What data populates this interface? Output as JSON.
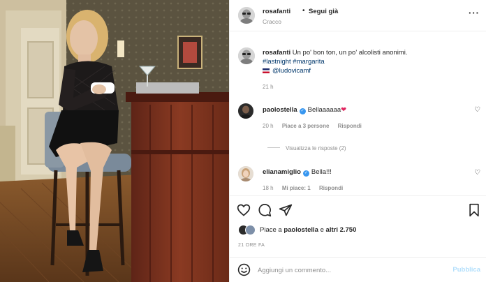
{
  "post": {
    "author": "rosafanti",
    "follow_label": "Segui già",
    "location": "Cracco",
    "more_glyph": "···"
  },
  "caption": {
    "username": "rosafanti",
    "text": "Un po' bon ton, un po' alcolisti anonimi.",
    "hashtags": "#lastnight #margarita",
    "mention": "@ludovicamf",
    "time": "21 h"
  },
  "comments": [
    {
      "username": "paolostella",
      "text": "Bellaaaaaa",
      "emoji": "❤",
      "time": "20 h",
      "likes": "Piace a 3 persone",
      "reply": "Rispondi"
    },
    {
      "username": "elianamiglio",
      "text": "Bella!!!",
      "time": "18 h",
      "likes": "Mi piace: 1",
      "reply": "Rispondi"
    }
  ],
  "view_replies": "Visualizza le risposte (2)",
  "likes_bar": {
    "prefix": "Piace a",
    "user": "paolostella",
    "joiner": "e",
    "others": "altri 2.750"
  },
  "posted_ago": "21 ORE FA",
  "add_comment": {
    "placeholder": "Aggiungi un commento...",
    "publish": "Pubblica"
  },
  "icons": [
    "heart-icon",
    "comment-icon",
    "share-icon",
    "bookmark-icon",
    "emoji-icon",
    "verified-icon",
    "more-icon"
  ],
  "colors": {
    "link": "#00376b",
    "verified": "#3897f0",
    "publish_disabled": "#b2dffc",
    "muted": "#8e8e8e",
    "heart_red": "#e0245e"
  }
}
